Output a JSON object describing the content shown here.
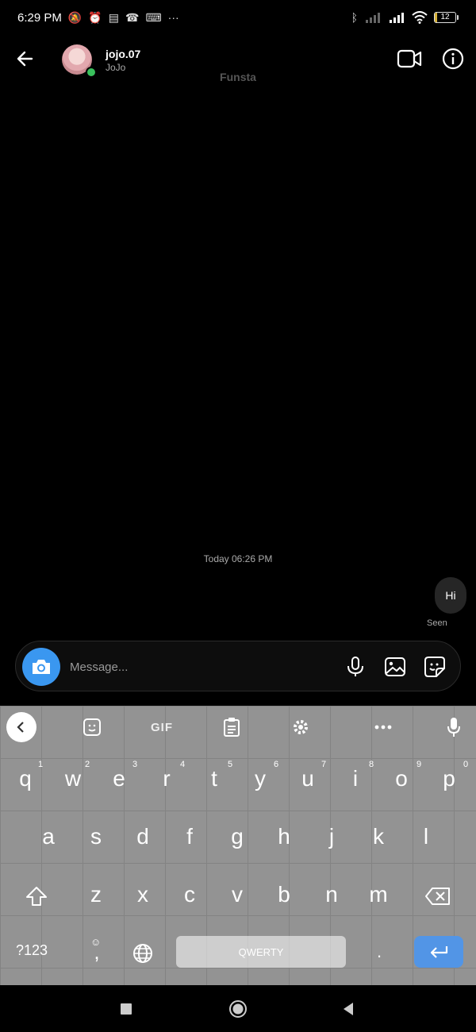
{
  "status": {
    "time": "6:29 PM",
    "battery_percent": "12",
    "battery_level": 0.12,
    "battery_color": "#d8b33a"
  },
  "header": {
    "user_name": "jojo.07",
    "user_subtitle": "JoJo",
    "chat_title": "Funsta",
    "online_color": "#39c05c"
  },
  "messages": {
    "timestamp": "Today 06:26 PM",
    "items": [
      {
        "text": "Hi",
        "from": "me"
      }
    ],
    "seen_label": "Seen"
  },
  "composer": {
    "placeholder": "Message...",
    "value": "",
    "accent": "#3a97f0"
  },
  "keyboard": {
    "toolbar": {
      "gif_label": "GIF"
    },
    "row1": [
      "q",
      "w",
      "e",
      "r",
      "t",
      "y",
      "u",
      "i",
      "o",
      "p"
    ],
    "row1_hints": [
      "1",
      "2",
      "3",
      "4",
      "5",
      "6",
      "7",
      "8",
      "9",
      "0"
    ],
    "row2": [
      "a",
      "s",
      "d",
      "f",
      "g",
      "h",
      "j",
      "k",
      "l"
    ],
    "row3": [
      "z",
      "x",
      "c",
      "v",
      "b",
      "n",
      "m"
    ],
    "symbols_label": "?123",
    "comma": ",",
    "period": ".",
    "space_label": "QWERTY",
    "enter_color": "#5295e6"
  },
  "icons": {
    "back": "arrow-left-icon",
    "video": "video-camera-icon",
    "info": "info-icon",
    "camera": "camera-icon",
    "mic": "microphone-icon",
    "gallery": "image-icon",
    "sticker": "sticker-icon"
  }
}
